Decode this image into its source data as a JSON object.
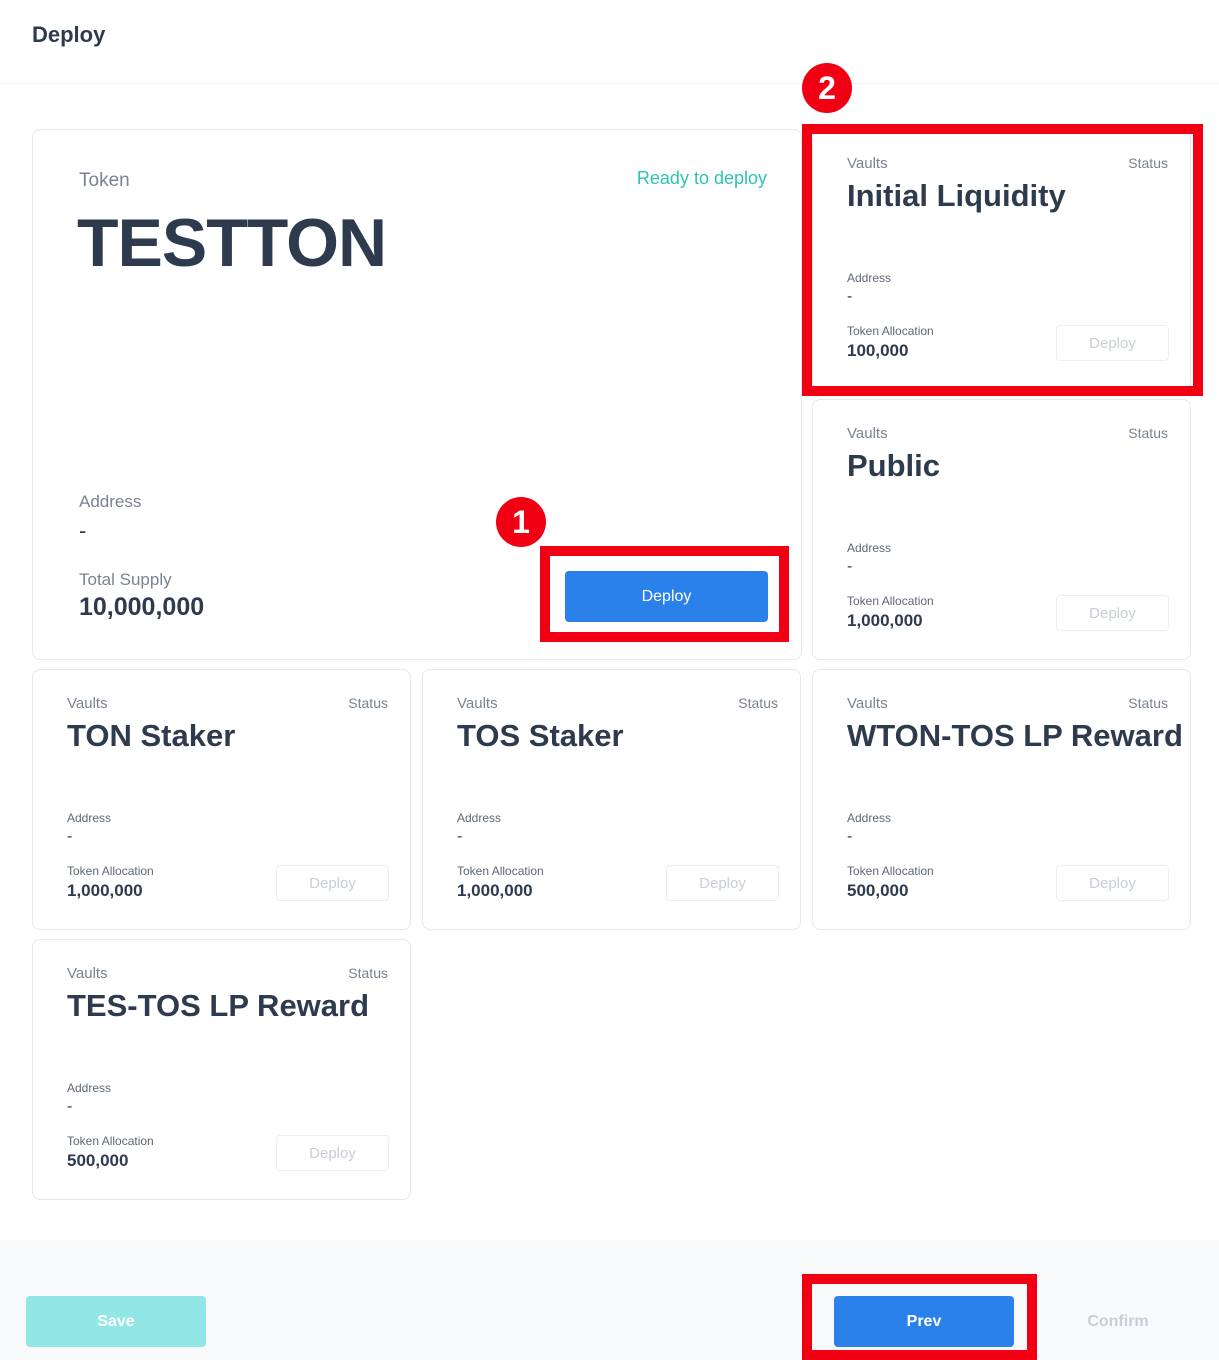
{
  "header": {
    "title": "Deploy"
  },
  "token": {
    "label": "Token",
    "name": "TESTTON",
    "status": "Ready to deploy",
    "address_label": "Address",
    "address": "-",
    "supply_label": "Total Supply",
    "supply": "10,000,000",
    "deploy_label": "Deploy"
  },
  "vaults": [
    {
      "label": "Vaults",
      "status": "Status",
      "name": "Initial Liquidity",
      "address_label": "Address",
      "address": "-",
      "alloc_label": "Token Allocation",
      "alloc": "100,000",
      "deploy_label": "Deploy"
    },
    {
      "label": "Vaults",
      "status": "Status",
      "name": "Public",
      "address_label": "Address",
      "address": "-",
      "alloc_label": "Token Allocation",
      "alloc": "1,000,000",
      "deploy_label": "Deploy"
    },
    {
      "label": "Vaults",
      "status": "Status",
      "name": "TON Staker",
      "address_label": "Address",
      "address": "-",
      "alloc_label": "Token Allocation",
      "alloc": "1,000,000",
      "deploy_label": "Deploy"
    },
    {
      "label": "Vaults",
      "status": "Status",
      "name": "TOS Staker",
      "address_label": "Address",
      "address": "-",
      "alloc_label": "Token Allocation",
      "alloc": "1,000,000",
      "deploy_label": "Deploy"
    },
    {
      "label": "Vaults",
      "status": "Status",
      "name": "WTON-TOS LP Reward",
      "address_label": "Address",
      "address": "-",
      "alloc_label": "Token Allocation",
      "alloc": "500,000",
      "deploy_label": "Deploy"
    },
    {
      "label": "Vaults",
      "status": "Status",
      "name": "TES-TOS LP Reward",
      "address_label": "Address",
      "address": "-",
      "alloc_label": "Token Allocation",
      "alloc": "500,000",
      "deploy_label": "Deploy"
    }
  ],
  "footer": {
    "save_label": "Save",
    "prev_label": "Prev",
    "confirm_label": "Confirm"
  },
  "annotations": {
    "marker_1": "1",
    "marker_2": "2",
    "highlight_color": "#f00012"
  },
  "colors": {
    "primary": "#2a81ea",
    "status": "#2fc4b2",
    "save": "#93e6e6"
  }
}
